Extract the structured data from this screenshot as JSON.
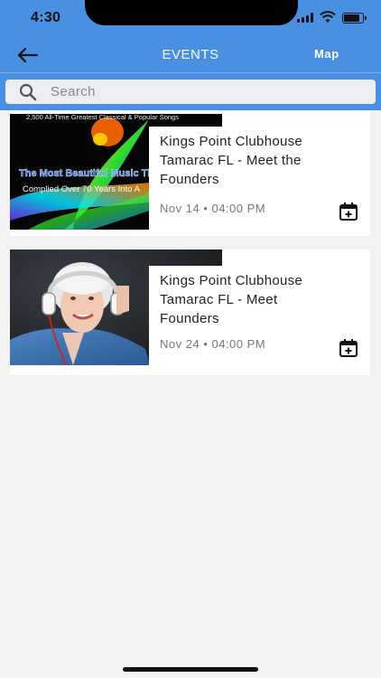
{
  "status_bar": {
    "time": "4:30"
  },
  "header": {
    "title": "EVENTS",
    "map_label": "Map"
  },
  "search": {
    "placeholder": "Search"
  },
  "events": [
    {
      "title": "Kings Point Clubhouse Tamarac FL - Meet the Founders",
      "date": "Nov 14 • 04:00 PM",
      "image_text": {
        "line1": "2,500 All-Time Greatest Classical & Popular Songs",
        "line2": "The Most Beautiful Music This S",
        "line3": "Complied Over 70 Years Into A"
      }
    },
    {
      "title": "Kings Point Clubhouse Tamarac FL - Meet Founders",
      "date": "Nov 24 • 04:00 PM"
    }
  ],
  "colors": {
    "header": "#4a90e2",
    "background": "#f2f2f2",
    "card": "#ffffff"
  }
}
